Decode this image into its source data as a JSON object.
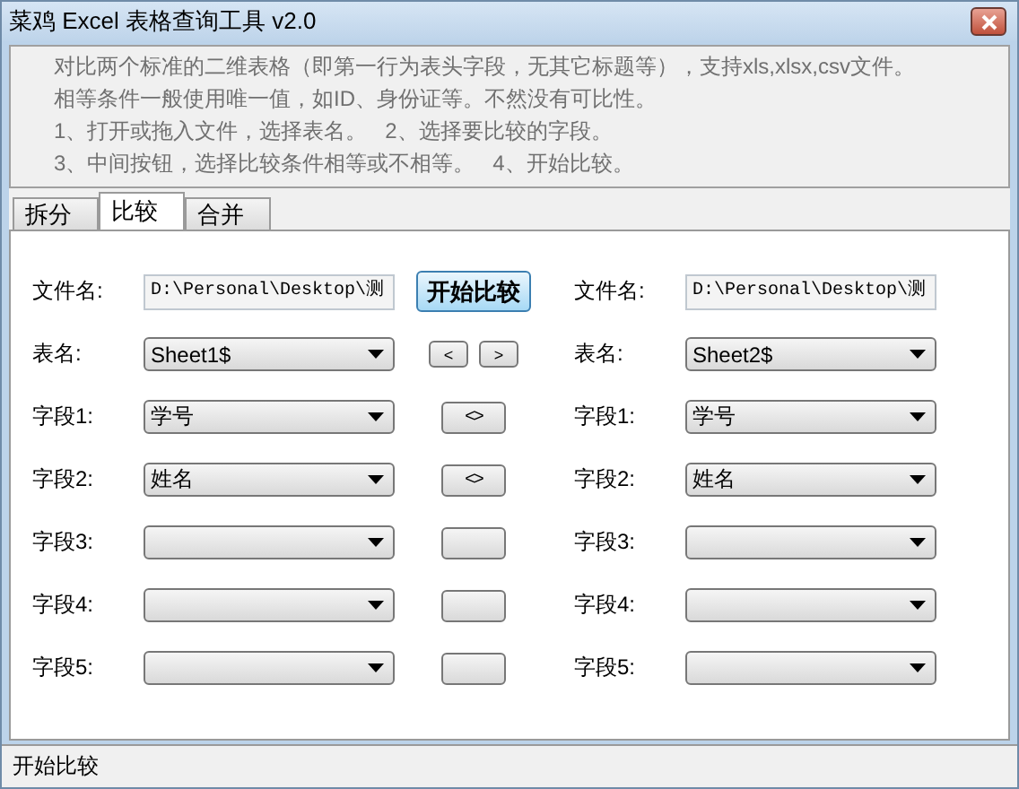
{
  "window": {
    "title": "菜鸡 Excel 表格查询工具 v2.0"
  },
  "description": [
    "对比两个标准的二维表格（即第一行为表头字段，无其它标题等），支持xls,xlsx,csv文件。",
    "相等条件一般使用唯一值，如ID、身份证等。不然没有可比性。",
    "1、打开或拖入文件，选择表名。   2、选择要比较的字段。",
    "3、中间按钮，选择比较条件相等或不相等。   4、开始比较。"
  ],
  "tabs": [
    {
      "label": "拆分",
      "selected": false
    },
    {
      "label": "比较",
      "selected": true
    },
    {
      "label": "合并",
      "selected": false
    }
  ],
  "left": {
    "file_label": "文件名:",
    "file_value": "D:\\Personal\\Desktop\\测",
    "sheet_label": "表名:",
    "sheet_value": "Sheet1$",
    "fields": [
      {
        "label": "字段1:",
        "value": "学号"
      },
      {
        "label": "字段2:",
        "value": "姓名"
      },
      {
        "label": "字段3:"
      },
      {
        "label": "字段4:"
      },
      {
        "label": "字段5:"
      }
    ]
  },
  "middle": {
    "start_button": "开始比较",
    "nav_buttons": [
      "<",
      ">"
    ],
    "operators": [
      {
        "kind": "operator",
        "symbol": "<>"
      },
      {
        "kind": "operator",
        "symbol": "<>"
      },
      {
        "kind": "blank"
      },
      {
        "kind": "blank"
      },
      {
        "kind": "blank"
      }
    ]
  },
  "right": {
    "file_label": "文件名:",
    "file_value": "D:\\Personal\\Desktop\\测",
    "sheet_label": "表名:",
    "sheet_value": "Sheet2$",
    "fields": [
      {
        "label": "字段1:",
        "value": "学号"
      },
      {
        "label": "字段2:",
        "value": "姓名"
      },
      {
        "label": "字段3:"
      },
      {
        "label": "字段4:"
      },
      {
        "label": "字段5:"
      }
    ]
  },
  "status_bar": "开始比较"
}
